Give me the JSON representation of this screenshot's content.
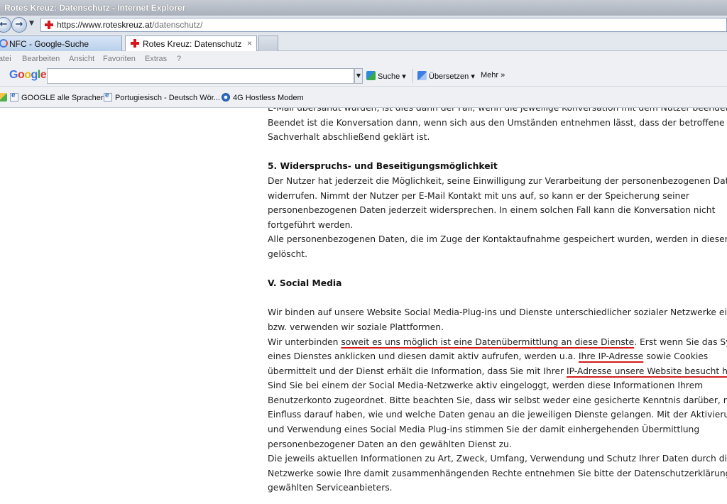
{
  "window": {
    "title": "Rotes Kreuz: Datenschutz - Internet Explorer"
  },
  "address": {
    "prefix": "https://www.",
    "host": "roteskreuz.at",
    "path": "/datenschutz/"
  },
  "tabs": [
    {
      "label": "NFC - Google-Suche"
    },
    {
      "label": "Rotes Kreuz: Datenschutz",
      "close": "×"
    }
  ],
  "menu": [
    "atei",
    "Bearbeiten",
    "Ansicht",
    "Favoriten",
    "Extras",
    "?"
  ],
  "googlebar": {
    "logo": "Google",
    "search_value": "",
    "search_label": "Suche",
    "translate_label": "Übersetzen",
    "more_label": "Mehr »"
  },
  "favorites": [
    {
      "label": "GOOGLE alle Sprachen"
    },
    {
      "label": "Portugiesisch - Deutsch Wör..."
    },
    {
      "label": "4G Hostless Modem"
    }
  ],
  "article": {
    "top_lines": [
      "E-Mail übersandt wurden, ist dies dann der Fall, wenn die jeweilige Konversation mit dem Nutzer beendet ist.",
      "Beendet ist die Konversation dann, wenn sich aus den Umständen entnehmen lässt, dass der betroffene",
      "Sachverhalt abschließend geklärt ist."
    ],
    "section5": {
      "heading": "5. Widerspruchs- und Beseitigungsmöglichkeit",
      "lines": [
        "Der Nutzer hat jederzeit die Möglichkeit, seine Einwilligung zur Verarbeitung der personenbezogenen Daten zu",
        "widerrufen. Nimmt der Nutzer per E-Mail Kontakt mit uns auf, so kann er der Speicherung seiner",
        "personenbezogenen Daten jederzeit widersprechen. In einem solchen Fall kann die Konversation nicht",
        "fortgeführt werden.",
        "Alle personenbezogenen Daten, die im Zuge der Kontaktaufnahme gespeichert wurden, werden in diesem Fall",
        "gelöscht."
      ]
    },
    "sectionV": {
      "heading": "V. Social Media",
      "lines": [
        "Wir binden auf unsere Website Social Media-Plug-ins und Dienste unterschiedlicher sozialer Netzwerke ein",
        "bzw. verwenden wir soziale Plattformen."
      ],
      "underlined": {
        "l1_pre": "Wir unterbinden ",
        "l1_ul": "soweit es uns möglich ist eine Datenübermittlung an diese Dienste",
        "l1_post": ". Erst wenn Sie das Symbol",
        "l2_pre": "eines Dienstes anklicken und diesen damit aktiv aufrufen, werden u.a. ",
        "l2_ul": "Ihre IP-Adresse",
        "l2_post": " sowie Cookies",
        "l3_pre": "übermittelt und der Dienst erhält die Information, dass Sie mit Ihrer ",
        "l3_ul": "IP-Adresse unsere Website besucht haben."
      },
      "rest_lines": [
        "Sind Sie bei einem der Social Media-Netzwerke aktiv eingeloggt, werden diese Informationen Ihrem",
        "Benutzerkonto zugeordnet. Bitte beachten Sie, dass wir selbst weder eine gesicherte Kenntnis darüber, noch",
        "Einfluss darauf haben, wie und welche Daten genau an die jeweiligen Dienste gelangen. Mit der Aktivierung",
        "und Verwendung eines Social Media Plug-ins stimmen Sie der damit einhergehenden Übermittlung",
        "personenbezogener Daten an den gewählten Dienst zu.",
        "Die jeweils aktuellen Informationen zu Art, Zweck, Umfang, Verwendung und Schutz Ihrer Daten durch diese",
        "Netzwerke sowie Ihre damit zusammenhängenden Rechte entnehmen Sie bitte der Datenschutzerklärung des",
        "gewählten Serviceanbieters."
      ]
    }
  },
  "colors": {
    "annotation_red": "#d11d1d",
    "brand_red": "#d8171a"
  }
}
